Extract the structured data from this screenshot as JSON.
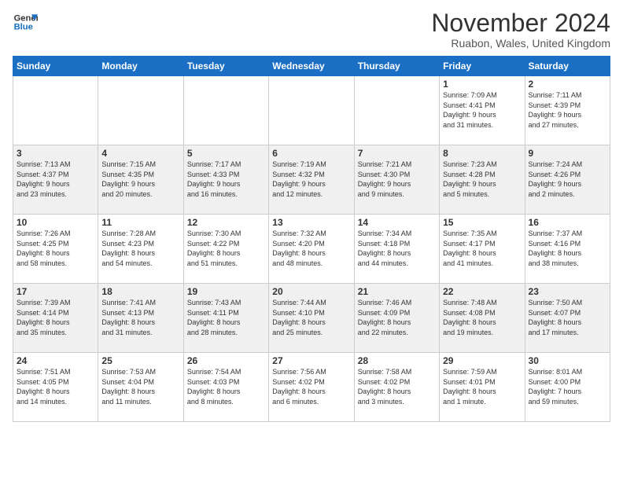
{
  "header": {
    "logo": {
      "line1": "General",
      "line2": "Blue"
    },
    "title": "November 2024",
    "location": "Ruabon, Wales, United Kingdom"
  },
  "weekdays": [
    "Sunday",
    "Monday",
    "Tuesday",
    "Wednesday",
    "Thursday",
    "Friday",
    "Saturday"
  ],
  "weeks": [
    [
      {
        "day": "",
        "info": ""
      },
      {
        "day": "",
        "info": ""
      },
      {
        "day": "",
        "info": ""
      },
      {
        "day": "",
        "info": ""
      },
      {
        "day": "",
        "info": ""
      },
      {
        "day": "1",
        "info": "Sunrise: 7:09 AM\nSunset: 4:41 PM\nDaylight: 9 hours\nand 31 minutes."
      },
      {
        "day": "2",
        "info": "Sunrise: 7:11 AM\nSunset: 4:39 PM\nDaylight: 9 hours\nand 27 minutes."
      }
    ],
    [
      {
        "day": "3",
        "info": "Sunrise: 7:13 AM\nSunset: 4:37 PM\nDaylight: 9 hours\nand 23 minutes."
      },
      {
        "day": "4",
        "info": "Sunrise: 7:15 AM\nSunset: 4:35 PM\nDaylight: 9 hours\nand 20 minutes."
      },
      {
        "day": "5",
        "info": "Sunrise: 7:17 AM\nSunset: 4:33 PM\nDaylight: 9 hours\nand 16 minutes."
      },
      {
        "day": "6",
        "info": "Sunrise: 7:19 AM\nSunset: 4:32 PM\nDaylight: 9 hours\nand 12 minutes."
      },
      {
        "day": "7",
        "info": "Sunrise: 7:21 AM\nSunset: 4:30 PM\nDaylight: 9 hours\nand 9 minutes."
      },
      {
        "day": "8",
        "info": "Sunrise: 7:23 AM\nSunset: 4:28 PM\nDaylight: 9 hours\nand 5 minutes."
      },
      {
        "day": "9",
        "info": "Sunrise: 7:24 AM\nSunset: 4:26 PM\nDaylight: 9 hours\nand 2 minutes."
      }
    ],
    [
      {
        "day": "10",
        "info": "Sunrise: 7:26 AM\nSunset: 4:25 PM\nDaylight: 8 hours\nand 58 minutes."
      },
      {
        "day": "11",
        "info": "Sunrise: 7:28 AM\nSunset: 4:23 PM\nDaylight: 8 hours\nand 54 minutes."
      },
      {
        "day": "12",
        "info": "Sunrise: 7:30 AM\nSunset: 4:22 PM\nDaylight: 8 hours\nand 51 minutes."
      },
      {
        "day": "13",
        "info": "Sunrise: 7:32 AM\nSunset: 4:20 PM\nDaylight: 8 hours\nand 48 minutes."
      },
      {
        "day": "14",
        "info": "Sunrise: 7:34 AM\nSunset: 4:18 PM\nDaylight: 8 hours\nand 44 minutes."
      },
      {
        "day": "15",
        "info": "Sunrise: 7:35 AM\nSunset: 4:17 PM\nDaylight: 8 hours\nand 41 minutes."
      },
      {
        "day": "16",
        "info": "Sunrise: 7:37 AM\nSunset: 4:16 PM\nDaylight: 8 hours\nand 38 minutes."
      }
    ],
    [
      {
        "day": "17",
        "info": "Sunrise: 7:39 AM\nSunset: 4:14 PM\nDaylight: 8 hours\nand 35 minutes."
      },
      {
        "day": "18",
        "info": "Sunrise: 7:41 AM\nSunset: 4:13 PM\nDaylight: 8 hours\nand 31 minutes."
      },
      {
        "day": "19",
        "info": "Sunrise: 7:43 AM\nSunset: 4:11 PM\nDaylight: 8 hours\nand 28 minutes."
      },
      {
        "day": "20",
        "info": "Sunrise: 7:44 AM\nSunset: 4:10 PM\nDaylight: 8 hours\nand 25 minutes."
      },
      {
        "day": "21",
        "info": "Sunrise: 7:46 AM\nSunset: 4:09 PM\nDaylight: 8 hours\nand 22 minutes."
      },
      {
        "day": "22",
        "info": "Sunrise: 7:48 AM\nSunset: 4:08 PM\nDaylight: 8 hours\nand 19 minutes."
      },
      {
        "day": "23",
        "info": "Sunrise: 7:50 AM\nSunset: 4:07 PM\nDaylight: 8 hours\nand 17 minutes."
      }
    ],
    [
      {
        "day": "24",
        "info": "Sunrise: 7:51 AM\nSunset: 4:05 PM\nDaylight: 8 hours\nand 14 minutes."
      },
      {
        "day": "25",
        "info": "Sunrise: 7:53 AM\nSunset: 4:04 PM\nDaylight: 8 hours\nand 11 minutes."
      },
      {
        "day": "26",
        "info": "Sunrise: 7:54 AM\nSunset: 4:03 PM\nDaylight: 8 hours\nand 8 minutes."
      },
      {
        "day": "27",
        "info": "Sunrise: 7:56 AM\nSunset: 4:02 PM\nDaylight: 8 hours\nand 6 minutes."
      },
      {
        "day": "28",
        "info": "Sunrise: 7:58 AM\nSunset: 4:02 PM\nDaylight: 8 hours\nand 3 minutes."
      },
      {
        "day": "29",
        "info": "Sunrise: 7:59 AM\nSunset: 4:01 PM\nDaylight: 8 hours\nand 1 minute."
      },
      {
        "day": "30",
        "info": "Sunrise: 8:01 AM\nSunset: 4:00 PM\nDaylight: 7 hours\nand 59 minutes."
      }
    ]
  ]
}
